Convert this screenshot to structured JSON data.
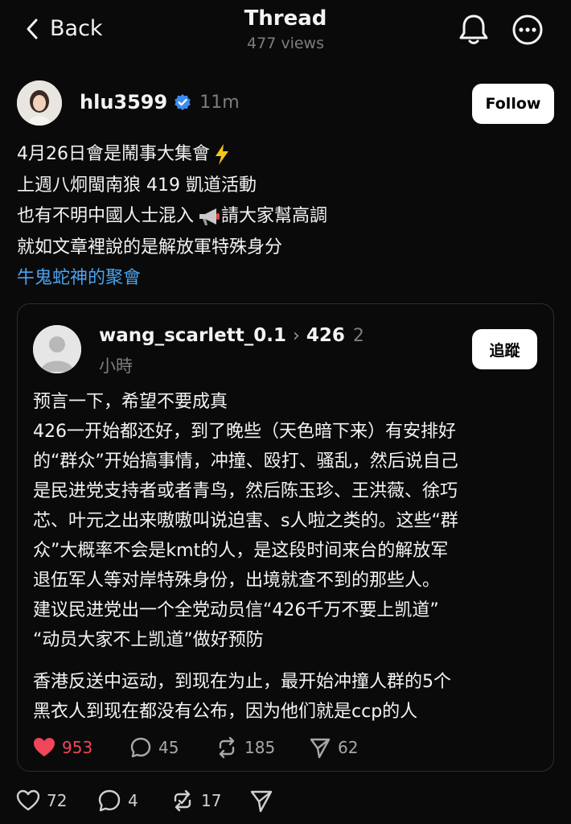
{
  "header": {
    "back_label": "Back",
    "title": "Thread",
    "views": "477 views",
    "bell_icon": "bell-icon",
    "more_icon": "more-icon"
  },
  "post": {
    "author": "hlu3599",
    "verified": true,
    "time": "11m",
    "follow_label": "Follow",
    "lines": [
      "4月26日會是鬧事大集會",
      "上週八炯閩南狼 419 凱道活動",
      "也有不明中國人士混入",
      "請大家幫高調",
      "就如文章裡說的是解放軍特殊身分"
    ],
    "link_text": "牛鬼蛇神的聚會"
  },
  "quoted": {
    "author": "wang_scarlett_0.1",
    "target": "426",
    "time_a": "2",
    "time_b": "小時",
    "follow_label": "追蹤",
    "lines": [
      "预言一下，希望不要成真",
      "426一开始都还好，到了晚些（天色暗下来）有安排好",
      "的“群众”开始搞事情，冲撞、殴打、骚乱，然后说自己",
      "是民进党支持者或者青鸟，然后陈玉珍、王洪薇、徐巧",
      "芯、叶元之出来嗷嗷叫说迫害、s人啦之类的。这些“群",
      "众”大概率不会是kmt的人，是这段时间来台的解放军",
      "退伍军人等对岸特殊身份，出境就查不到的那些人。",
      "建议民进党出一个全党动员信“426千万不要上凯道”",
      "“动员大家不上凯道”做好预防",
      "香港反送中运动，到现在为止，最开始冲撞人群的5个",
      "黑衣人到现在都没有公布，因为他们就是ccp的人"
    ],
    "stats": {
      "likes": "953",
      "replies": "45",
      "reposts": "185",
      "shares": "62"
    }
  },
  "actions": {
    "likes": "72",
    "replies": "4",
    "reposts": "17"
  },
  "colors": {
    "background": "#0a0a0a",
    "link": "#4aa3f0",
    "liked": "#f0455a",
    "verified": "#3b8cf0"
  }
}
